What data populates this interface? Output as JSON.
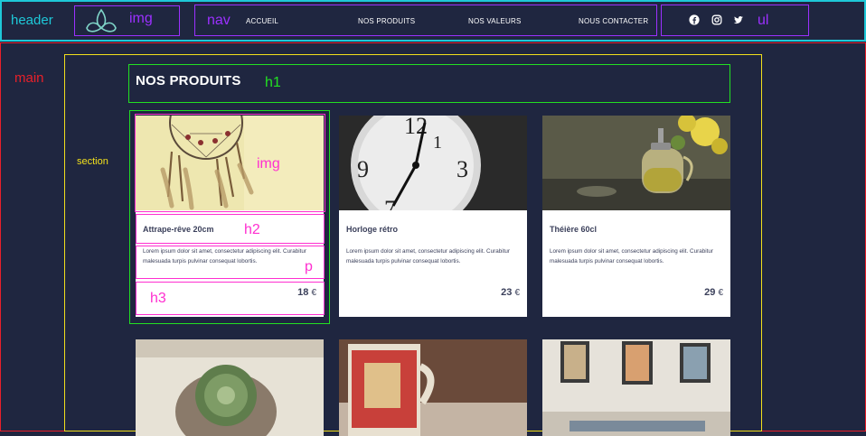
{
  "annotations": {
    "header": "header",
    "img_logo": "img",
    "nav": "nav",
    "ul": "ul",
    "main": "main",
    "section": "section",
    "h1": "h1",
    "img_card": "img",
    "h2": "h2",
    "p": "p",
    "h3": "h3",
    "colors": {
      "header": "#1ec8d8",
      "main": "#e8202a",
      "section": "#f2e01c",
      "h1": "#22e022",
      "element": "#9b30ff",
      "card_parts": "#ff2fd0"
    }
  },
  "header": {
    "logo_icon": "triquetra-icon",
    "nav": [
      "ACCUEIL",
      "NOS PRODUITS",
      "NOS VALEURS",
      "NOUS CONTACTER"
    ],
    "social": [
      "facebook-icon",
      "instagram-icon",
      "twitter-icon"
    ]
  },
  "main": {
    "title": "NOS PRODUITS",
    "products": [
      {
        "name": "Attrape-rêve 20cm",
        "desc": "Lorem ipsum dolor sit amet, consectetur adipiscing elit. Curabitur malesuada turpis pulvinar consequat lobortis.",
        "price": "18",
        "currency": "€",
        "image": "dreamcatcher-photo"
      },
      {
        "name": "Horloge rétro",
        "desc": "Lorem ipsum dolor sit amet, consectetur adipiscing elit. Curabitur malesuada turpis pulvinar consequat lobortis.",
        "price": "23",
        "currency": "€",
        "image": "clock-photo"
      },
      {
        "name": "Théière 60cl",
        "desc": "Lorem ipsum dolor sit amet, consectetur adipiscing elit. Curabitur malesuada turpis pulvinar consequat lobortis.",
        "price": "29",
        "currency": "€",
        "image": "teapot-photo"
      },
      {
        "name": "",
        "desc": "",
        "price": "",
        "currency": "",
        "image": "cactus-photo"
      },
      {
        "name": "",
        "desc": "",
        "price": "",
        "currency": "",
        "image": "mug-photo"
      },
      {
        "name": "",
        "desc": "",
        "price": "",
        "currency": "",
        "image": "frames-photo"
      }
    ]
  }
}
